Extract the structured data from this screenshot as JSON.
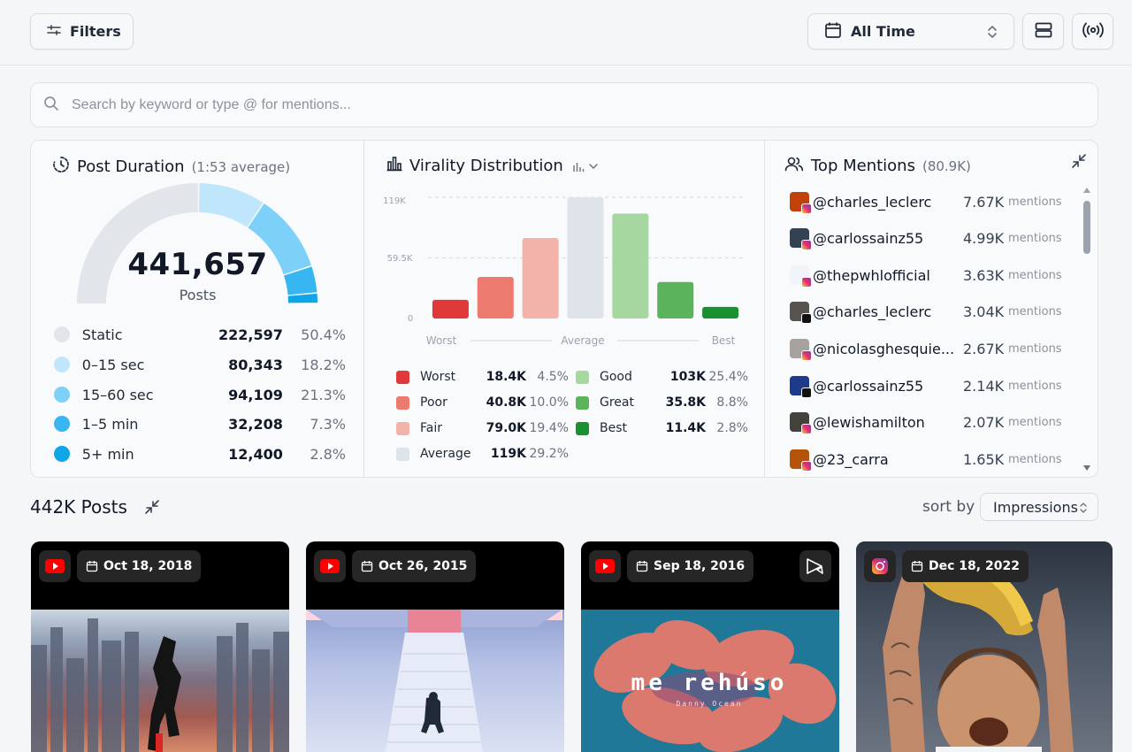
{
  "toolbar": {
    "filters_label": "Filters",
    "time_range": "All Time"
  },
  "search": {
    "placeholder": "Search by keyword or type @ for mentions..."
  },
  "post_duration": {
    "title": "Post Duration",
    "subtitle": "(1:53 average)",
    "total": "441,657",
    "total_label": "Posts",
    "rows": [
      {
        "label": "Static",
        "value": "222,597",
        "pct": "50.4%",
        "fraction": 0.504,
        "color": "#e2e5ea"
      },
      {
        "label": "0–15 sec",
        "value": "80,343",
        "pct": "18.2%",
        "fraction": 0.182,
        "color": "#bfe6fb"
      },
      {
        "label": "15–60 sec",
        "value": "94,109",
        "pct": "21.3%",
        "fraction": 0.213,
        "color": "#7dd0f7"
      },
      {
        "label": "1–5 min",
        "value": "32,208",
        "pct": "7.3%",
        "fraction": 0.073,
        "color": "#38b6f1"
      },
      {
        "label": "5+ min",
        "value": "12,400",
        "pct": "2.8%",
        "fraction": 0.028,
        "color": "#0ea5e9"
      }
    ]
  },
  "virality": {
    "title": "Virality Distribution",
    "y_ticks": [
      "119K",
      "59.5K",
      "0"
    ],
    "axis": {
      "left": "Worst",
      "middle": "Average",
      "right": "Best"
    },
    "legend": [
      {
        "label": "Worst",
        "value": "18.4K",
        "pct": "4.5%",
        "color": "#e0393a"
      },
      {
        "label": "Poor",
        "value": "40.8K",
        "pct": "10.0%",
        "color": "#ec7a6e"
      },
      {
        "label": "Fair",
        "value": "79.0K",
        "pct": "19.4%",
        "color": "#f3b3aa"
      },
      {
        "label": "Average",
        "value": "119K",
        "pct": "29.2%",
        "color": "#dfe3ea"
      },
      {
        "label": "Good",
        "value": "103K",
        "pct": "25.4%",
        "color": "#a6d7a0"
      },
      {
        "label": "Great",
        "value": "35.8K",
        "pct": "8.8%",
        "color": "#5bb35b"
      },
      {
        "label": "Best",
        "value": "11.4K",
        "pct": "2.8%",
        "color": "#1a9131"
      }
    ]
  },
  "chart_data": {
    "type": "bar",
    "categories": [
      "Worst",
      "Poor",
      "Fair",
      "Average",
      "Good",
      "Great",
      "Best"
    ],
    "values": [
      18400,
      40800,
      79000,
      119000,
      103000,
      35800,
      11400
    ],
    "ylim": [
      0,
      119000
    ],
    "y_ticks": [
      "119K",
      "59.5K",
      "0"
    ],
    "xlabel": "",
    "ylabel": "",
    "grid": true
  },
  "mentions": {
    "title": "Top Mentions",
    "subtitle": "(80.9K)",
    "unit": "mentions",
    "items": [
      {
        "handle": "@charles_leclerc",
        "count": "7.67K",
        "platform": "instagram",
        "avatar_color": "#c2410c"
      },
      {
        "handle": "@carlossainz55",
        "count": "4.99K",
        "platform": "instagram",
        "avatar_color": "#334155"
      },
      {
        "handle": "@thepwhlofficial",
        "count": "3.63K",
        "platform": "instagram",
        "avatar_color": "#f1f5f9"
      },
      {
        "handle": "@charles_leclerc",
        "count": "3.04K",
        "platform": "x",
        "avatar_color": "#57534e"
      },
      {
        "handle": "@nicolasghesquie...",
        "count": "2.67K",
        "platform": "instagram",
        "avatar_color": "#a8a29e"
      },
      {
        "handle": "@carlossainz55",
        "count": "2.14K",
        "platform": "x",
        "avatar_color": "#1e3a8a"
      },
      {
        "handle": "@lewishamilton",
        "count": "2.07K",
        "platform": "instagram",
        "avatar_color": "#44403c"
      },
      {
        "handle": "@23_carra",
        "count": "1.65K",
        "platform": "instagram",
        "avatar_color": "#b45309"
      }
    ]
  },
  "posts": {
    "title": "442K Posts",
    "sort_label": "sort by",
    "sort_value": "Impressions",
    "cards": [
      {
        "platform": "youtube",
        "date": "Oct 18, 2018"
      },
      {
        "platform": "youtube",
        "date": "Oct 26, 2015"
      },
      {
        "platform": "youtube",
        "date": "Sep 18, 2016",
        "overlay_text": "me rehúso",
        "overlay_sub": "Danny Ocean"
      },
      {
        "platform": "instagram",
        "date": "Dec 18, 2022"
      }
    ]
  }
}
